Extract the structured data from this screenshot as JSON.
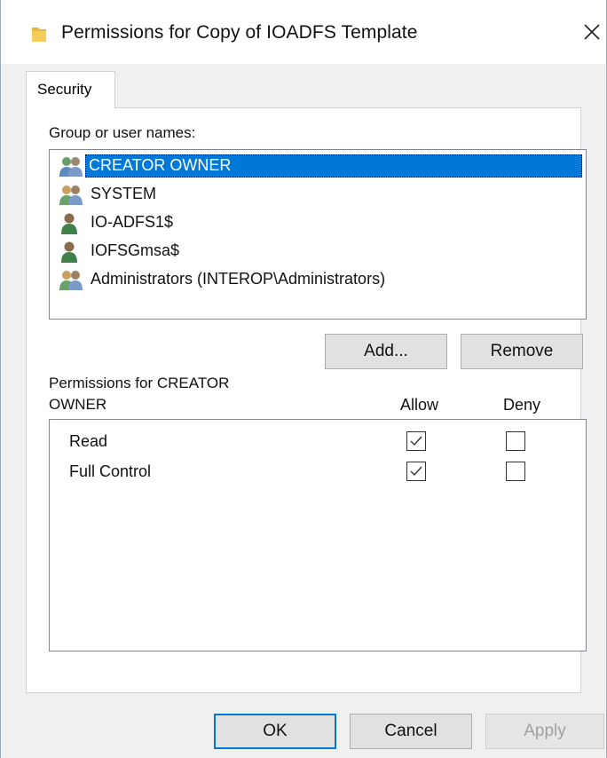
{
  "window": {
    "title": "Permissions for Copy of IOADFS Template",
    "title_icon": "folder-icon",
    "close_icon": "close-icon"
  },
  "tabs": [
    {
      "label": "Security",
      "selected": true
    }
  ],
  "group_label": "Group or user names:",
  "users": [
    {
      "name": "CREATOR OWNER",
      "icon": "users-group-icon",
      "selected": true
    },
    {
      "name": "SYSTEM",
      "icon": "users-group-icon",
      "selected": false
    },
    {
      "name": "IO-ADFS1$",
      "icon": "user-icon",
      "selected": false
    },
    {
      "name": "IOFSGmsa$",
      "icon": "user-icon",
      "selected": false
    },
    {
      "name": "Administrators (INTEROP\\Administrators)",
      "icon": "users-group-icon",
      "selected": false
    }
  ],
  "buttons": {
    "add": "Add...",
    "remove": "Remove",
    "ok": "OK",
    "cancel": "Cancel",
    "apply": "Apply"
  },
  "permissions_label_line1": "Permissions for CREATOR",
  "permissions_label_line2": "OWNER",
  "columns": {
    "allow": "Allow",
    "deny": "Deny"
  },
  "permissions": [
    {
      "name": "Read",
      "allow": true,
      "deny": false
    },
    {
      "name": "Full Control",
      "allow": true,
      "deny": false
    }
  ],
  "colors": {
    "selection": "#0078d7",
    "dialog_background": "#f0f0f0",
    "default_button_border": "#0078d7"
  }
}
